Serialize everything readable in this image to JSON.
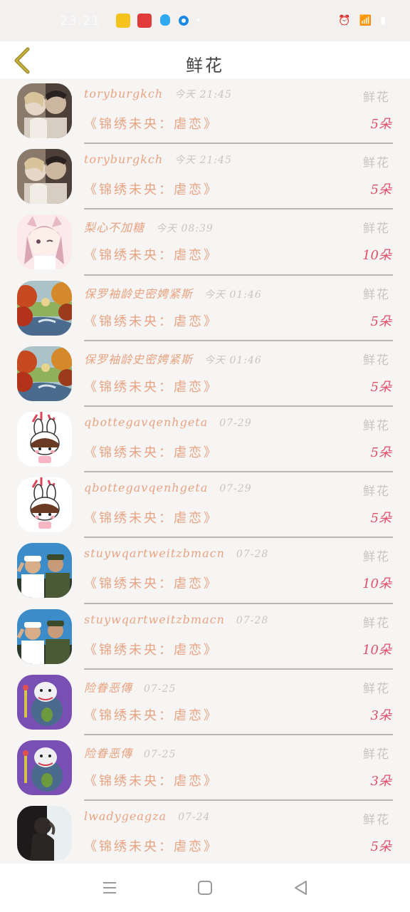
{
  "status_bar": {
    "time": "23:21"
  },
  "header": {
    "title": "鲜花"
  },
  "colors": {
    "accent": "#e8a482",
    "count": "#e0506a",
    "muted": "#c9c4c4"
  },
  "rows": [
    {
      "avatar": "couple-photo",
      "user": "toryburgkch",
      "time": "今天 21:45",
      "gift": "鲜花",
      "book": "《锦绣未央：虐恋》",
      "count": "5朵"
    },
    {
      "avatar": "couple-photo",
      "user": "toryburgkch",
      "time": "今天 21:45",
      "gift": "鲜花",
      "book": "《锦绣未央：虐恋》",
      "count": "5朵"
    },
    {
      "avatar": "anime-girl",
      "user": "梨心不加糖",
      "time": "今天 08:39",
      "gift": "鲜花",
      "book": "《锦绣未央：虐恋》",
      "count": "10朵"
    },
    {
      "avatar": "autumn-landscape",
      "user": "保罗袖龄史密娉紧斯",
      "time": "今天 01:46",
      "gift": "鲜花",
      "book": "《锦绣未央：虐恋》",
      "count": "5朵"
    },
    {
      "avatar": "autumn-landscape",
      "user": "保罗袖龄史密娉紧斯",
      "time": "今天 01:46",
      "gift": "鲜花",
      "book": "《锦绣未央：虐恋》",
      "count": "5朵"
    },
    {
      "avatar": "bunny-girl",
      "user": "qbottegavqenhgeta",
      "time": "07-29",
      "gift": "鲜花",
      "book": "《锦绣未央：虐恋》",
      "count": "5朵"
    },
    {
      "avatar": "bunny-girl",
      "user": "qbottegavqenhgeta",
      "time": "07-29",
      "gift": "鲜花",
      "book": "《锦绣未央：虐恋》",
      "count": "5朵"
    },
    {
      "avatar": "soldiers",
      "user": "stuywqartweitzbmacn",
      "time": "07-28",
      "gift": "鲜花",
      "book": "《锦绣未央：虐恋》",
      "count": "10朵"
    },
    {
      "avatar": "soldiers",
      "user": "stuywqartweitzbmacn",
      "time": "07-28",
      "gift": "鲜花",
      "book": "《锦绣未央：虐恋》",
      "count": "10朵"
    },
    {
      "avatar": "cartoon-bear",
      "user": "险眷恶傳",
      "time": "07-25",
      "gift": "鲜花",
      "book": "《锦绣未央：虐恋》",
      "count": "3朵"
    },
    {
      "avatar": "cartoon-bear",
      "user": "险眷恶傳",
      "time": "07-25",
      "gift": "鲜花",
      "book": "《锦绣未央：虐恋》",
      "count": "3朵"
    },
    {
      "avatar": "dark-portrait",
      "user": "lwadygeagza",
      "time": "07-24",
      "gift": "鲜花",
      "book": "《锦绣未央：虐恋》",
      "count": "5朵"
    }
  ],
  "nav": {
    "icons": [
      "menu-icon",
      "home-square-icon",
      "back-triangle-icon"
    ]
  }
}
